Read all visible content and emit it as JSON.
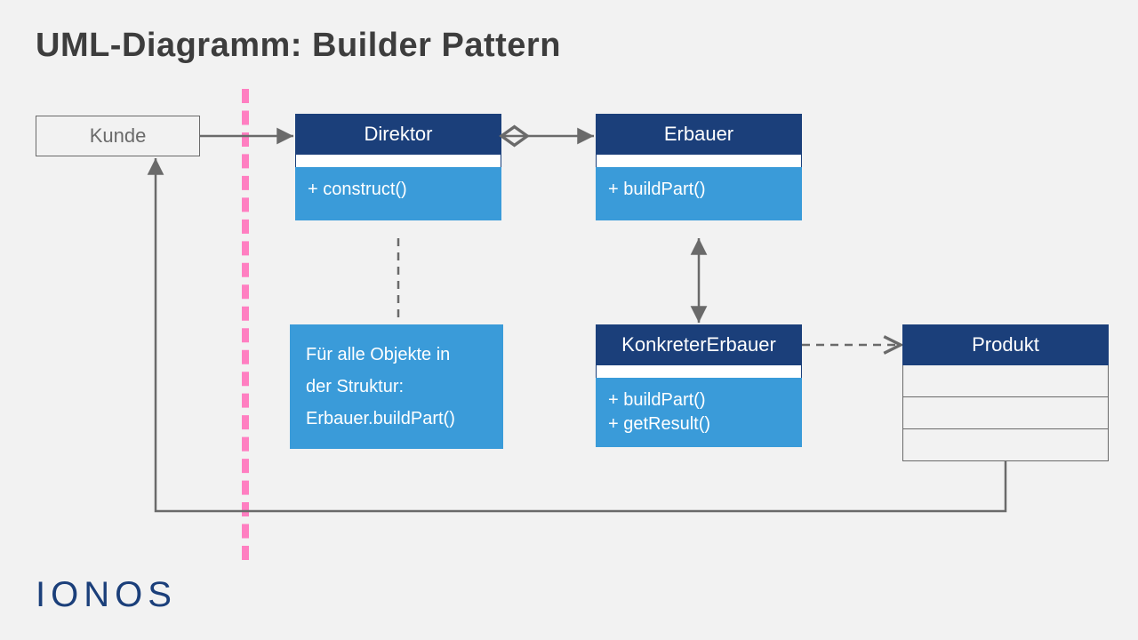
{
  "title": "UML-Diagramm: Builder Pattern",
  "logo": "IONOS",
  "boxes": {
    "kunde": {
      "label": "Kunde"
    },
    "direktor": {
      "name": "Direktor",
      "methods": [
        "+ construct()"
      ]
    },
    "erbauer": {
      "name": "Erbauer",
      "methods": [
        "+ buildPart()"
      ]
    },
    "konkreter": {
      "name": "KonkreterErbauer",
      "methods": [
        "+ buildPart()",
        "+ getResult()"
      ]
    },
    "produkt": {
      "name": "Produkt",
      "empty_rows": 3
    }
  },
  "note": {
    "line1": "Für alle Objekte in",
    "line2": "der Struktur:",
    "line3": "Erbauer.buildPart()"
  },
  "colors": {
    "header": "#1b3f7a",
    "body": "#3a9bd9",
    "edge": "#6a6a6a",
    "pink": "#ff7fc1",
    "bg": "#f2f2f2"
  },
  "connections": [
    {
      "from": "Kunde",
      "to": "Direktor",
      "style": "solid-arrow"
    },
    {
      "from": "Direktor",
      "to": "Erbauer",
      "style": "solid-diamond-bidir"
    },
    {
      "from": "Erbauer",
      "to": "KonkreterErbauer",
      "style": "solid-bidir"
    },
    {
      "from": "KonkreterErbauer",
      "to": "Produkt",
      "style": "dashed-arrow"
    },
    {
      "from": "Direktor",
      "to": "Note",
      "style": "dashed"
    },
    {
      "from": "Produkt",
      "to": "Kunde",
      "style": "solid-arrow-route"
    }
  ]
}
